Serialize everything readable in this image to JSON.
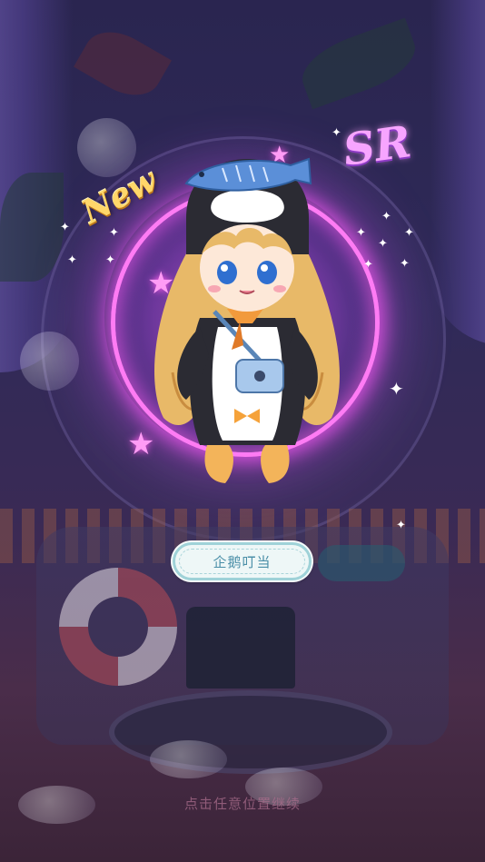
{
  "reveal": {
    "new_badge": "New",
    "rarity": "SR",
    "item_name": "企鹅叮当"
  },
  "footer": {
    "hint": "点击任意位置继续"
  },
  "colors": {
    "glow": "#ff7bf4",
    "background": "#2f2a58",
    "pill_border": "#9fd2d8",
    "pill_text": "#4b8fa8"
  },
  "icons": [
    "sparkle-icon",
    "star-icon"
  ]
}
